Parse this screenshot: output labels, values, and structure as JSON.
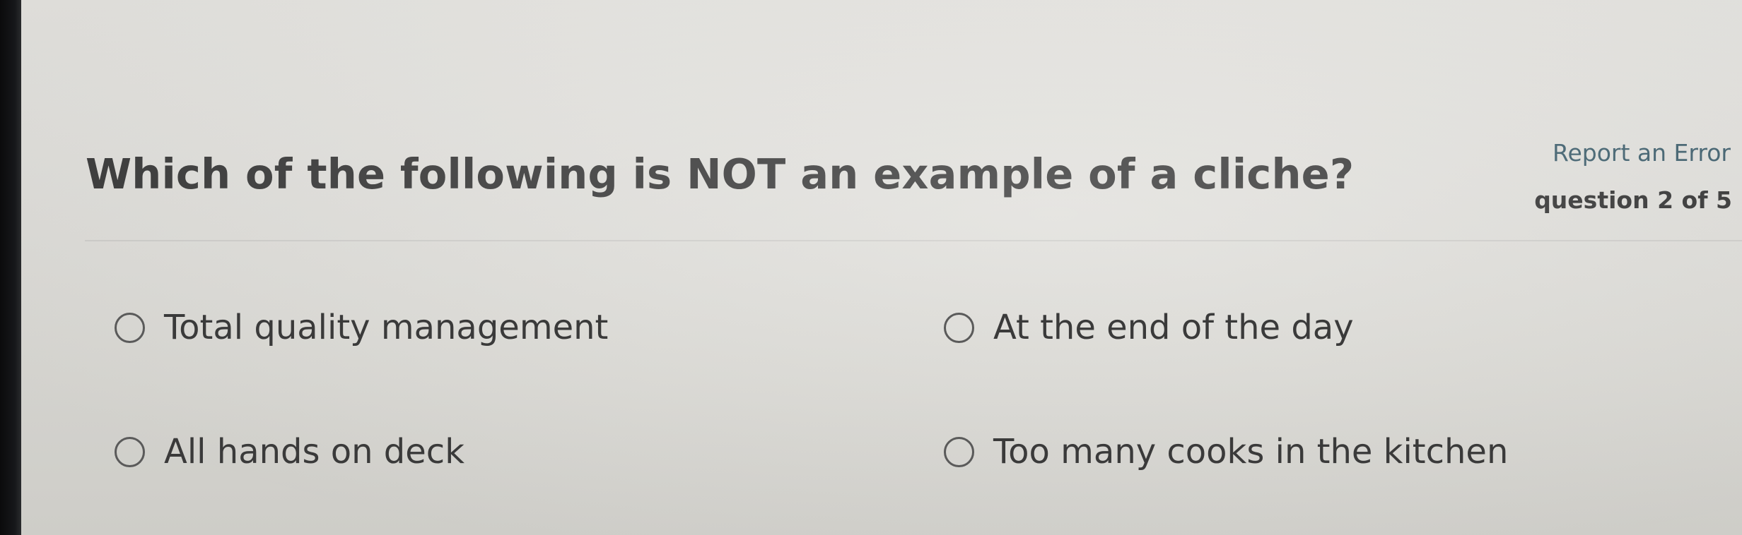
{
  "question": {
    "text": "Which of the following is NOT an example of a cliche?",
    "report_link": "Report an Error",
    "progress": "question 2 of 5",
    "options": [
      {
        "label": "Total quality management",
        "selected": false
      },
      {
        "label": "At the end of the day",
        "selected": false
      },
      {
        "label": "All hands on deck",
        "selected": false
      },
      {
        "label": "Too many cooks in the kitchen",
        "selected": false
      }
    ]
  },
  "colors": {
    "page_background": "#e3e2de",
    "text": "#3a3a3a",
    "link": "#3e5f6d",
    "radio_border": "#5a5a5a"
  },
  "icons": [
    "radio-unchecked-icon"
  ]
}
